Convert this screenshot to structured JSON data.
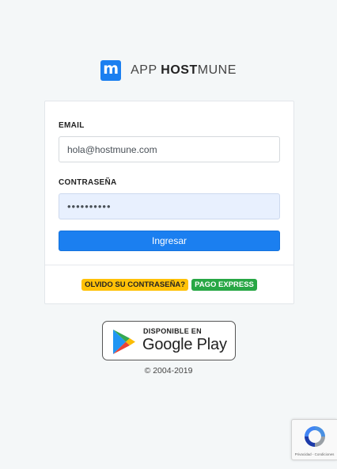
{
  "header": {
    "logo_letter": "m",
    "brand_prefix": "APP ",
    "brand_bold": "HOST",
    "brand_suffix": "MUNE"
  },
  "form": {
    "email_label": "EMAIL",
    "email_value": "hola@hostmune.com",
    "password_label": "CONTRASEÑA",
    "password_value": "••••••••••",
    "submit_label": "Ingresar"
  },
  "links": {
    "forgot_label": "OLVIDO SU CONTRASEÑA?",
    "express_label": "PAGO EXPRESS"
  },
  "store_badge": {
    "top_text": "DISPONIBLE EN",
    "main_text": "Google Play"
  },
  "footer": {
    "copyright": "© 2004-2019"
  },
  "recaptcha": {
    "text": "Privacidad - Condiciones"
  },
  "colors": {
    "primary": "#1b7ff0",
    "warning": "#ffc107",
    "success": "#28a745"
  }
}
